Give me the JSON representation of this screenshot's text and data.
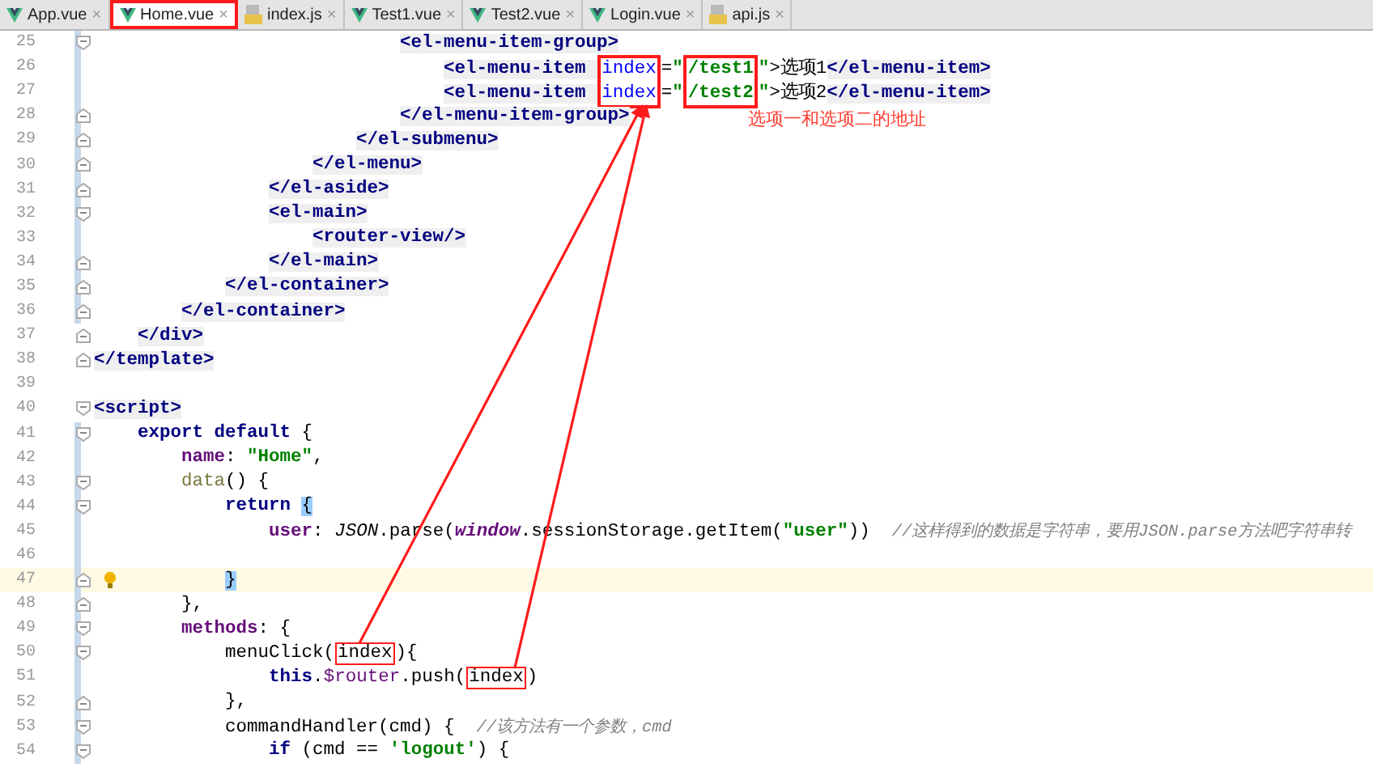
{
  "tabs": [
    {
      "label": "App.vue",
      "kind": "vue",
      "selected": false
    },
    {
      "label": "Home.vue",
      "kind": "vue",
      "selected": true
    },
    {
      "label": "index.js",
      "kind": "js",
      "selected": false
    },
    {
      "label": "Test1.vue",
      "kind": "vue",
      "selected": false
    },
    {
      "label": "Test2.vue",
      "kind": "vue",
      "selected": false
    },
    {
      "label": "Login.vue",
      "kind": "vue",
      "selected": false
    },
    {
      "label": "api.js",
      "kind": "js",
      "selected": false
    }
  ],
  "close_glyph": "×",
  "lines": [
    {
      "number": "25",
      "fold_start": true,
      "fold_end": false,
      "modified": true,
      "current": false,
      "tokens": [
        {
          "kind": "tag",
          "text": "                            <el-menu-item-group>"
        }
      ]
    },
    {
      "number": "26",
      "fold_start": false,
      "fold_end": false,
      "modified": true,
      "current": false,
      "tokens": [
        {
          "kind": "tag",
          "text": "                                <el-menu-item ",
          "framed": false
        },
        {
          "kind": "attr",
          "text": "index",
          "framed": true
        },
        {
          "kind": "plain",
          "text": "=",
          "framed": false
        },
        {
          "kind": "string",
          "text": "\"",
          "framed": false
        },
        {
          "kind": "string",
          "text": "/test1",
          "framed": true
        },
        {
          "kind": "string",
          "text": "\"",
          "framed": false
        },
        {
          "kind": "plain",
          "text": ">选项1",
          "framed": false
        },
        {
          "kind": "tag",
          "text": "</el-menu-item>",
          "framed": false
        }
      ]
    },
    {
      "number": "27",
      "fold_start": false,
      "fold_end": false,
      "modified": true,
      "current": false,
      "tokens": [
        {
          "kind": "tag",
          "text": "                                <el-menu-item ",
          "framed": false
        },
        {
          "kind": "attr",
          "text": "index",
          "framed": true
        },
        {
          "kind": "plain",
          "text": "=",
          "framed": false
        },
        {
          "kind": "string",
          "text": "\"",
          "framed": false
        },
        {
          "kind": "string",
          "text": "/test2",
          "framed": true
        },
        {
          "kind": "string",
          "text": "\"",
          "framed": false
        },
        {
          "kind": "plain",
          "text": ">选项2",
          "framed": false
        },
        {
          "kind": "tag",
          "text": "</el-menu-item>",
          "framed": false
        }
      ]
    },
    {
      "number": "28",
      "fold_start": false,
      "fold_end": true,
      "modified": true,
      "current": false,
      "tokens": [
        {
          "kind": "tag",
          "text": "                            </el-menu-item-group>"
        }
      ]
    },
    {
      "number": "29",
      "fold_start": false,
      "fold_end": true,
      "modified": true,
      "current": false,
      "tokens": [
        {
          "kind": "tag",
          "text": "                        </el-submenu>"
        }
      ]
    },
    {
      "number": "30",
      "fold_start": false,
      "fold_end": true,
      "modified": true,
      "current": false,
      "tokens": [
        {
          "kind": "tag",
          "text": "                    </el-menu>"
        }
      ]
    },
    {
      "number": "31",
      "fold_start": false,
      "fold_end": true,
      "modified": true,
      "current": false,
      "tokens": [
        {
          "kind": "tag",
          "text": "                </el-aside>"
        }
      ]
    },
    {
      "number": "32",
      "fold_start": true,
      "fold_end": false,
      "modified": true,
      "current": false,
      "tokens": [
        {
          "kind": "tag",
          "text": "                <el-main>"
        }
      ]
    },
    {
      "number": "33",
      "fold_start": false,
      "fold_end": false,
      "modified": true,
      "current": false,
      "tokens": [
        {
          "kind": "tag",
          "text": "                    <router-view/>"
        }
      ]
    },
    {
      "number": "34",
      "fold_start": false,
      "fold_end": true,
      "modified": true,
      "current": false,
      "tokens": [
        {
          "kind": "tag",
          "text": "                </el-main>"
        }
      ]
    },
    {
      "number": "35",
      "fold_start": false,
      "fold_end": true,
      "modified": true,
      "current": false,
      "tokens": [
        {
          "kind": "tag",
          "text": "            </el-container>"
        }
      ]
    },
    {
      "number": "36",
      "fold_start": false,
      "fold_end": true,
      "modified": true,
      "current": false,
      "tokens": [
        {
          "kind": "tag",
          "text": "        </el-container>"
        }
      ]
    },
    {
      "number": "37",
      "fold_start": false,
      "fold_end": true,
      "modified": false,
      "current": false,
      "tokens": [
        {
          "kind": "tag",
          "text": "    </div>"
        }
      ]
    },
    {
      "number": "38",
      "fold_start": false,
      "fold_end": true,
      "modified": false,
      "current": false,
      "tokens": [
        {
          "kind": "tag",
          "text": "</template>"
        }
      ]
    },
    {
      "number": "39",
      "fold_start": false,
      "fold_end": false,
      "modified": false,
      "current": false
    },
    {
      "number": "40",
      "fold_start": true,
      "fold_end": false,
      "modified": false,
      "current": false,
      "tokens": [
        {
          "kind": "tag",
          "text": "<script>"
        }
      ]
    },
    {
      "number": "41",
      "fold_start": true,
      "fold_end": false,
      "modified": true,
      "current": false,
      "tokens": [
        {
          "kind": "keyword",
          "text": "    export default "
        },
        {
          "kind": "plain",
          "text": "{"
        }
      ]
    },
    {
      "number": "42",
      "fold_start": false,
      "fold_end": false,
      "modified": true,
      "current": false,
      "tokens": [
        {
          "kind": "prop",
          "text": "        name"
        },
        {
          "kind": "plain",
          "text": ": "
        },
        {
          "kind": "string",
          "text": "\"Home\""
        },
        {
          "kind": "plain",
          "text": ","
        }
      ]
    },
    {
      "number": "43",
      "fold_start": true,
      "fold_end": false,
      "modified": true,
      "current": false,
      "tokens": [
        {
          "kind": "method",
          "text": "        data"
        },
        {
          "kind": "plain",
          "text": "() {"
        }
      ]
    },
    {
      "number": "44",
      "fold_start": true,
      "fold_end": false,
      "modified": true,
      "current": false,
      "tokens": [
        {
          "kind": "keyword",
          "text": "            return "
        },
        {
          "kind": "brace",
          "text": "{"
        }
      ]
    },
    {
      "number": "45",
      "fold_start": false,
      "fold_end": false,
      "modified": true,
      "current": false,
      "tokens": [
        {
          "kind": "prop",
          "text": "                user"
        },
        {
          "kind": "plain",
          "text": ": "
        },
        {
          "kind": "global",
          "text": "JSON"
        },
        {
          "kind": "plain",
          "text": ".parse("
        },
        {
          "kind": "global-prop",
          "text": "window"
        },
        {
          "kind": "plain",
          "text": ".sessionStorage.getItem("
        },
        {
          "kind": "string",
          "text": "\"user\""
        },
        {
          "kind": "plain",
          "text": "))  "
        },
        {
          "kind": "comment",
          "text": "//这样得到的数据是字符串，要用JSON.parse方法吧字符串转"
        }
      ]
    },
    {
      "number": "46",
      "fold_start": false,
      "fold_end": false,
      "modified": true,
      "current": false
    },
    {
      "number": "47",
      "fold_start": false,
      "fold_end": true,
      "modified": true,
      "current": true,
      "tokens": [
        {
          "kind": "brace",
          "text": "            }"
        }
      ]
    },
    {
      "number": "48",
      "fold_start": false,
      "fold_end": true,
      "modified": true,
      "current": false,
      "tokens": [
        {
          "kind": "plain",
          "text": "        },"
        }
      ]
    },
    {
      "number": "49",
      "fold_start": true,
      "fold_end": false,
      "modified": true,
      "current": false,
      "tokens": [
        {
          "kind": "prop",
          "text": "        methods"
        },
        {
          "kind": "plain",
          "text": ": {"
        }
      ]
    },
    {
      "number": "50",
      "fold_start": true,
      "fold_end": false,
      "modified": true,
      "current": false,
      "tokens": [
        {
          "kind": "plain",
          "text": "            menuClick(",
          "framed": false
        },
        {
          "kind": "plain",
          "text": "index",
          "framed": true
        },
        {
          "kind": "plain",
          "text": "){",
          "framed": false
        }
      ]
    },
    {
      "number": "51",
      "fold_start": false,
      "fold_end": false,
      "modified": true,
      "current": false,
      "tokens": [
        {
          "kind": "keyword",
          "text": "                this",
          "framed": false
        },
        {
          "kind": "plain",
          "text": ".",
          "framed": false
        },
        {
          "kind": "prop-plain",
          "text": "$router",
          "framed": false
        },
        {
          "kind": "plain",
          "text": ".push(",
          "framed": false
        },
        {
          "kind": "plain",
          "text": "index",
          "framed": true
        },
        {
          "kind": "plain",
          "text": ")",
          "framed": false
        }
      ]
    },
    {
      "number": "52",
      "fold_start": false,
      "fold_end": true,
      "modified": true,
      "current": false,
      "tokens": [
        {
          "kind": "plain",
          "text": "            },"
        }
      ]
    },
    {
      "number": "53",
      "fold_start": true,
      "fold_end": false,
      "modified": true,
      "current": false,
      "tokens": [
        {
          "kind": "plain",
          "text": "            commandHandler(cmd) {  "
        },
        {
          "kind": "comment",
          "text": "//该方法有一个参数，cmd"
        }
      ]
    },
    {
      "number": "54",
      "fold_start": true,
      "fold_end": false,
      "modified": true,
      "current": false,
      "tokens": [
        {
          "kind": "keyword",
          "text": "                if "
        },
        {
          "kind": "plain",
          "text": "(cmd == "
        },
        {
          "kind": "string",
          "text": "'logout'"
        },
        {
          "kind": "plain",
          "text": ") {"
        }
      ]
    }
  ],
  "annotation": {
    "note": "选项一和选项二的地址"
  }
}
